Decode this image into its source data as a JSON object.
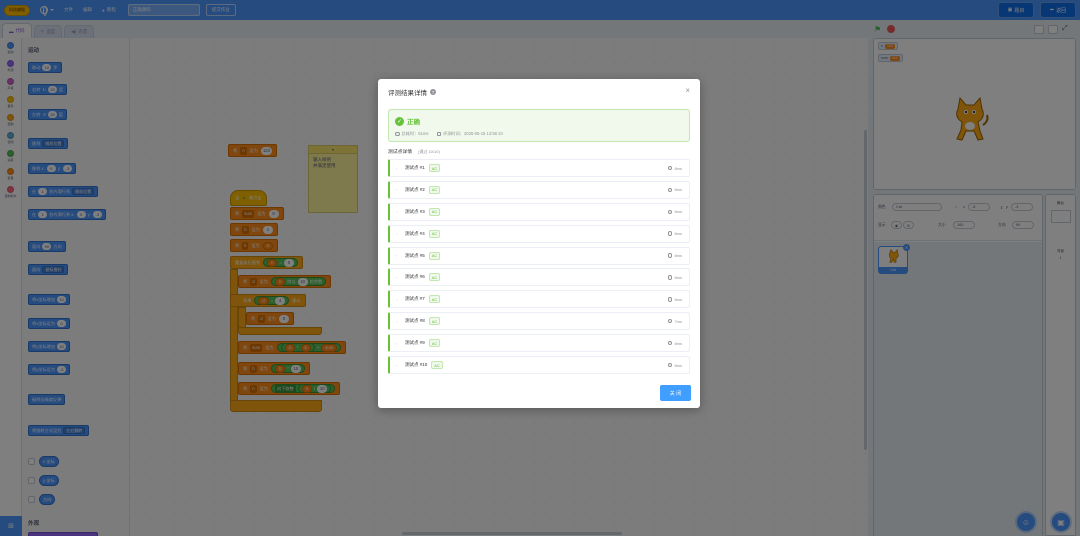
{
  "menubar": {
    "logo": "科技编程",
    "file": "文件",
    "edit": "编辑",
    "tutorial": "教程",
    "project_title": "正确源码",
    "share_btn": "提交作业",
    "right_btn1": "题目",
    "right_btn2": "返回",
    "accent": "#4c97ff"
  },
  "tabs": {
    "code": "代码",
    "costumes": "造型",
    "sounds": "声音"
  },
  "categories": [
    {
      "label": "运动",
      "color": "#4c97ff"
    },
    {
      "label": "外观",
      "color": "#9966ff"
    },
    {
      "label": "声音",
      "color": "#cf63cf"
    },
    {
      "label": "事件",
      "color": "#ffbf00"
    },
    {
      "label": "控制",
      "color": "#ffab19"
    },
    {
      "label": "侦测",
      "color": "#5cb1d6"
    },
    {
      "label": "运算",
      "color": "#59c059"
    },
    {
      "label": "变量",
      "color": "#ff8c1a"
    },
    {
      "label": "自制积木",
      "color": "#ff6680"
    }
  ],
  "palette": {
    "motion_head": "运动",
    "looks_head": "外观",
    "b_move": "移动",
    "b_move_n": "10",
    "b_move_unit": "步",
    "b_turn_r": "右转",
    "b_turn_r_n": "15",
    "b_deg": "度",
    "b_turn_l": "左转",
    "b_turn_l_n": "15",
    "b_goto": "移到",
    "b_goto_dd": "随机位置",
    "b_gotoxy": "移到 x:",
    "b_gotoxy_x": "0",
    "b_y": "y:",
    "b_gotoxy_y": "-3",
    "b_glide": "在",
    "b_glide_n": "1",
    "b_glide_mid": "秒内滑行到",
    "b_glide_dd": "随机位置",
    "b_glide2": "在",
    "b_glide2_n": "1",
    "b_glide2_mid": "秒内滑行到 x:",
    "b_glide2_x": "0",
    "b_glide2_y": "-3",
    "b_point": "面向",
    "b_point_n": "90",
    "b_point_unit": "方向",
    "b_pointto": "面向",
    "b_pointto_dd": "鼠标指针",
    "b_changex": "将x坐标增加",
    "b_changex_n": "10",
    "b_setx": "将x坐标设为",
    "b_setx_n": "0",
    "b_changey": "将y坐标增加",
    "b_changey_n": "10",
    "b_sety": "将y坐标设为",
    "b_sety_n": "-3",
    "b_bounce": "碰到边缘就反弹",
    "b_rotstyle": "将旋转方式设为",
    "b_rotstyle_dd": "左右翻转",
    "r_x": "x 坐标",
    "r_y": "y 坐标",
    "r_dir": "方向"
  },
  "code": {
    "b1_set": "将",
    "b1_var": "n",
    "b1_to": "设为",
    "b1_val": "123",
    "note_text1": "输入样例",
    "note_text2": "并满足使用",
    "hat": "当",
    "hat_clicked": "被点击",
    "s1_set": "将",
    "s1_var": "sum",
    "s1_to": "设为",
    "s1_val": "0",
    "s2_set": "将",
    "s2_var": "b",
    "s2_to": "设为",
    "s2_val": "1",
    "s3_set": "将",
    "s3_var": "k",
    "s3_to": "设为",
    "s3_val": "n",
    "rep": "重复执行直到",
    "rep_a": "n",
    "rep_op": "=",
    "rep_b": "0",
    "s4_set": "将",
    "s4_var": "d",
    "s4_to": "设为",
    "s4_a": "n",
    "s4_op": "除以",
    "s4_b": "10",
    "s4_tail": "的余数",
    "if": "如果",
    "if_a": "d",
    "if_op": "=",
    "if_b": "4",
    "if_then": "那么",
    "s5_set": "将",
    "s5_var": "d",
    "s5_to": "设为",
    "s5_val": "0",
    "s6_set": "将",
    "s6_var": "sum",
    "s6_to": "设为",
    "s6_a": "d",
    "s6_op": "*",
    "s6_b": "b",
    "s6_op2": "+",
    "s6_c": "sum",
    "s7_set": "将",
    "s7_var": "b",
    "s7_to": "设为",
    "s7_a": "b",
    "s7_op": "*",
    "s7_b": "10",
    "s8_set": "将",
    "s8_var": "n",
    "s8_to": "设为",
    "s8_fn": "向下取整",
    "s8_a": "n",
    "s8_op": "/",
    "s8_b": "10"
  },
  "stage": {
    "mon1_label": "n",
    "mon1_val": "123",
    "mon2_label": "sum",
    "mon2_val": "423"
  },
  "sprite_panel": {
    "sprite_label": "角色",
    "sprite_name": "Cat",
    "x_label": "x",
    "x_val": "-8",
    "y_label": "y",
    "y_val": "-3",
    "show_label": "显示",
    "size_label": "大小",
    "size_val": "100",
    "dir_label": "方向",
    "dir_val": "90",
    "thumb_name": "Cat",
    "stage_label": "舞台",
    "backdrop_label": "背景",
    "backdrop_count": "1"
  },
  "modal": {
    "title": "评测结果详情",
    "status": "正确",
    "total_time": "总耗时：81ms",
    "eval_time": "评测时间：2026-05-15 13:56:10",
    "cases_head": "测试点详情",
    "cases_sub": "(通过 10/10)",
    "cases": [
      {
        "name": "测试点 #1",
        "status": "AC",
        "time": "8ms"
      },
      {
        "name": "测试点 #2",
        "status": "AC",
        "time": "8ms"
      },
      {
        "name": "测试点 #3",
        "status": "AC",
        "time": "8ms"
      },
      {
        "name": "测试点 #4",
        "status": "AC",
        "time": "8ms"
      },
      {
        "name": "测试点 #5",
        "status": "AC",
        "time": "8ms"
      },
      {
        "name": "测试点 #6",
        "status": "AC",
        "time": "8ms"
      },
      {
        "name": "测试点 #7",
        "status": "AC",
        "time": "8ms"
      },
      {
        "name": "测试点 #8",
        "status": "AC",
        "time": "7ms"
      },
      {
        "name": "测试点 #9",
        "status": "AC",
        "time": "8ms"
      },
      {
        "name": "测试点 #10",
        "status": "AC",
        "time": "8ms"
      }
    ],
    "close_btn": "关 闭"
  }
}
